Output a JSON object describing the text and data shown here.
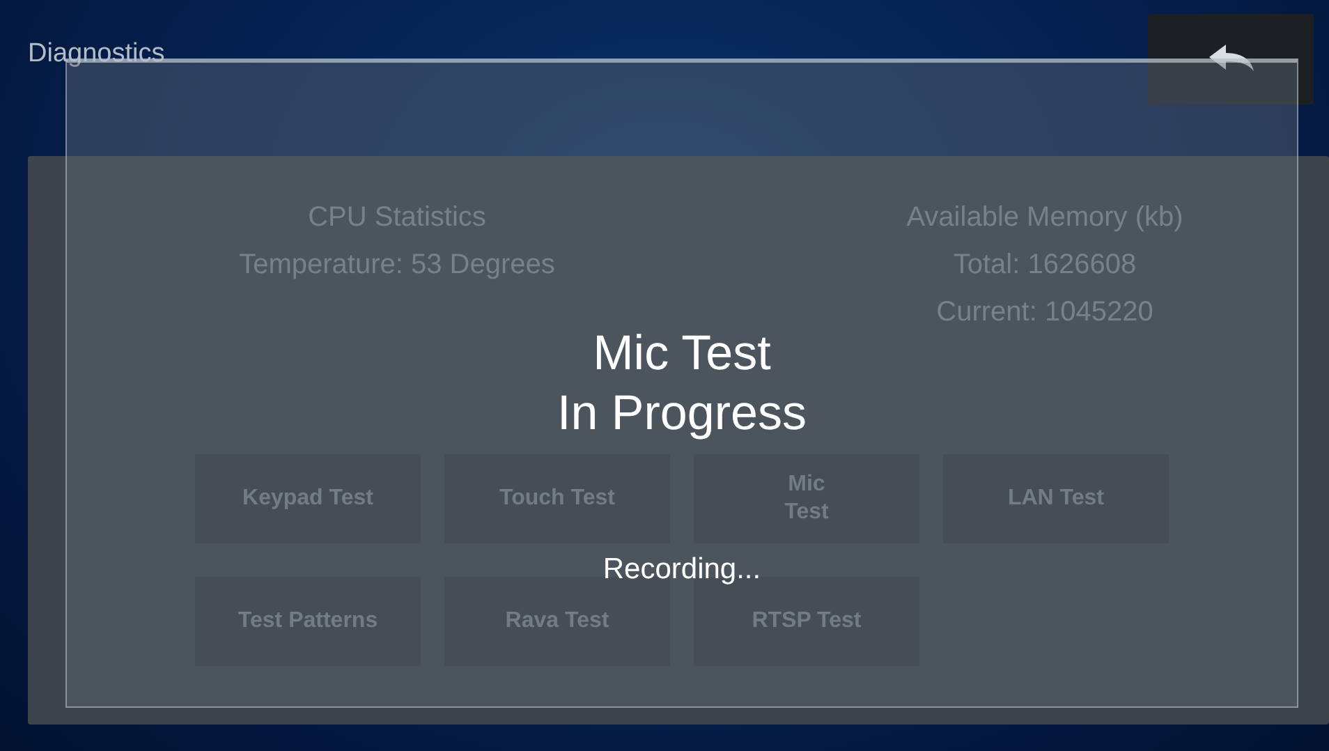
{
  "header": {
    "title": "Diagnostics"
  },
  "cpu": {
    "heading": "CPU Statistics",
    "temperature": "Temperature: 53 Degrees"
  },
  "memory": {
    "heading": "Available Memory (kb)",
    "total": "Total: 1626608",
    "current": "Current: 1045220"
  },
  "test_buttons": [
    {
      "label": "Keypad Test",
      "wrap": false
    },
    {
      "label": "Touch Test",
      "wrap": false
    },
    {
      "label": "Mic Test",
      "wrap": true
    },
    {
      "label": "LAN Test",
      "wrap": false
    },
    {
      "label": "Test Patterns",
      "wrap": false
    },
    {
      "label": "Rava Test",
      "wrap": false
    },
    {
      "label": "RTSP Test",
      "wrap": false
    }
  ],
  "dialog": {
    "title_lines": [
      "Mic Test",
      "In Progress"
    ],
    "status": "Recording..."
  }
}
